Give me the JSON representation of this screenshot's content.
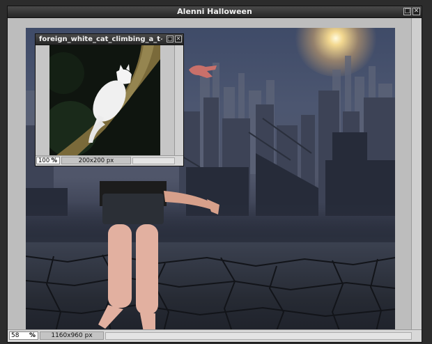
{
  "main_window": {
    "title": "Alenni Halloween",
    "zoom_value": "58",
    "zoom_unit": "%",
    "dimensions": "1160x960 px",
    "maximize_icon": "maximize-icon",
    "close_icon": "close-icon"
  },
  "sub_window": {
    "title": "foreign_white_cat_climbing_a_t~f",
    "zoom_value": "100",
    "zoom_unit": "%",
    "dimensions": "200x200 px",
    "maximize_icon": "maximize-icon",
    "close_icon": "close-icon"
  },
  "colors": {
    "titlebar": "#262626",
    "canvas_sky": "#4c5670",
    "ground": "#262a33",
    "window_bg": "#bdbdbd"
  }
}
